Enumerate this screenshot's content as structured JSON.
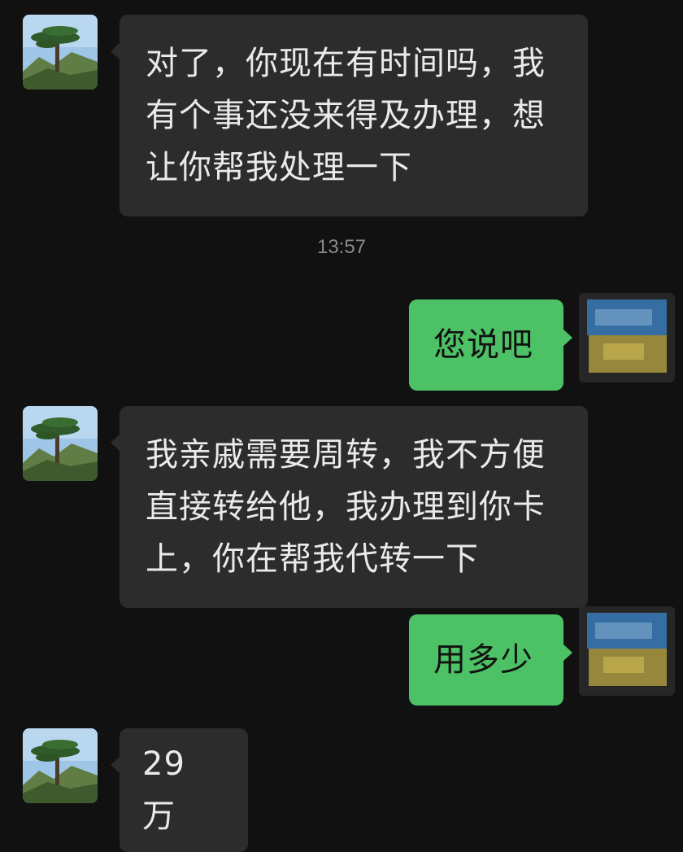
{
  "messages": [
    {
      "sender": "contact",
      "text": "对了，你现在有时间吗，我有个事还没来得及办理，想让你帮我处理一下"
    },
    {
      "sender": "self",
      "text": "您说吧"
    },
    {
      "sender": "contact",
      "text": "我亲戚需要周转，我不方便直接转给他，我办理到你卡上，你在帮我代转一下"
    },
    {
      "sender": "self",
      "text": "用多少"
    },
    {
      "sender": "contact",
      "text": "29 万"
    }
  ],
  "timestamp": "13:57",
  "colors": {
    "background": "#111111",
    "incoming_bubble": "#2c2c2c",
    "outgoing_bubble": "#4cc165",
    "incoming_text": "#eaeaea",
    "timestamp_text": "#8a8a8a"
  },
  "icons": {
    "contact_avatar": "pine-tree-landscape-avatar-icon",
    "self_avatar": "blurred-avatar-icon"
  }
}
